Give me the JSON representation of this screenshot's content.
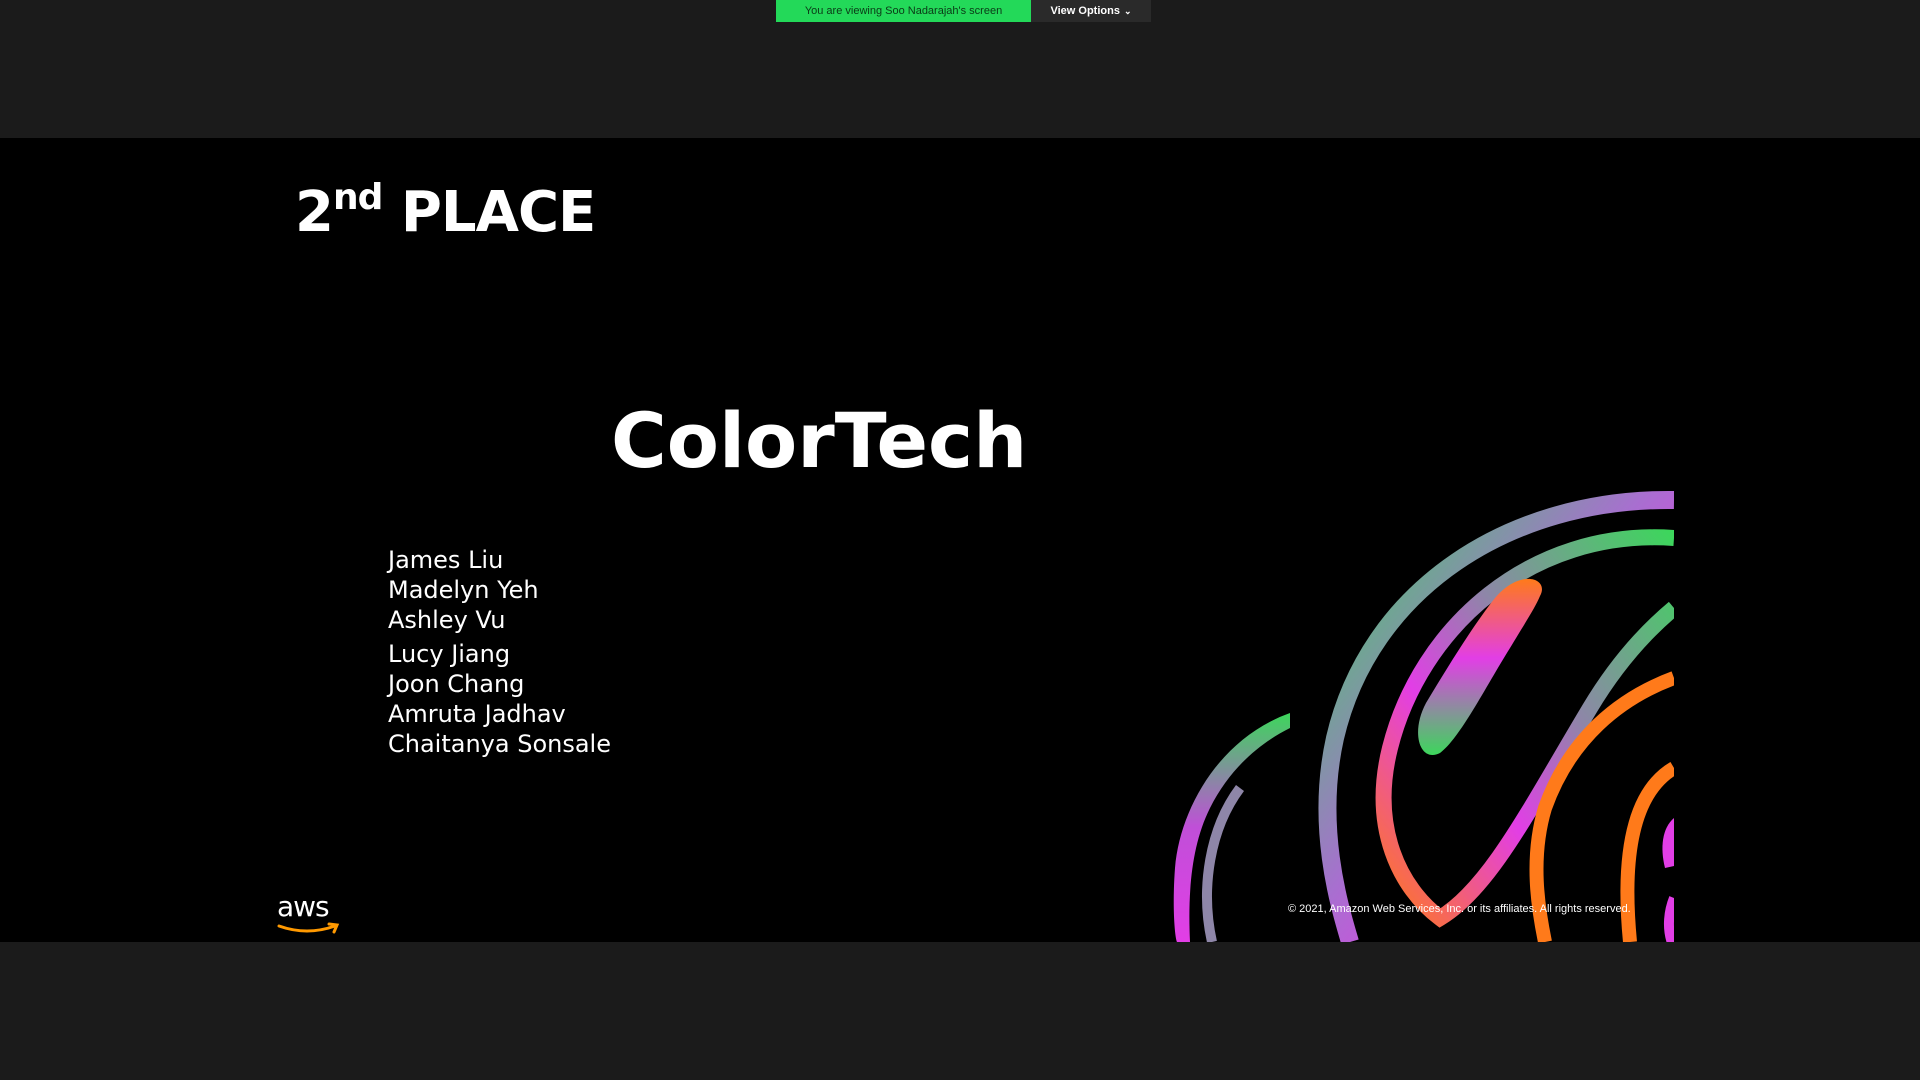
{
  "share_bar": {
    "banner_text": "You are viewing Soo Nadarajah's screen",
    "view_options_label": "View Options",
    "chevron_icon": "chevron-down-icon",
    "banner_color": "#23d959"
  },
  "slide": {
    "place_number": "2",
    "place_suffix": "nd",
    "place_word": "PLACE",
    "team_name": "ColorTech",
    "members": [
      "James Liu",
      "Madelyn Yeh",
      "Ashley Vu",
      "Lucy Jiang",
      "Joon Chang",
      "Amruta Jadhav",
      "Chaitanya Sonsale"
    ],
    "logo_text": "aws",
    "copyright": "© 2021, Amazon Web Services, Inc. or its affiliates. All rights reserved.",
    "accent_colors": [
      "#3dd65c",
      "#e23ee6",
      "#ff7a1a"
    ]
  }
}
